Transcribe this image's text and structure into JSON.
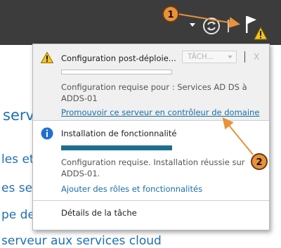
{
  "callouts": {
    "one": "1",
    "two": "2"
  },
  "background": {
    "line1": "serv",
    "line2": "les et",
    "line3": "es serv",
    "line4": "pe de",
    "line5": "serveur aux services cloud"
  },
  "task1": {
    "title": "Configuration post-déploie...",
    "task_button": "TÂCH...",
    "close": "X",
    "desc_line1": "Configuration requise pour : Services AD DS à",
    "desc_line2": "ADDS-01",
    "link": "Promouvoir ce serveur en contrôleur de domaine",
    "progress": 0
  },
  "task2": {
    "title": "Installation de fonctionnalité",
    "desc_line1": "Configuration requise. Installation réussie sur",
    "desc_line2": "ADDS-01.",
    "link": "Ajouter des rôles et fonctionnalités",
    "progress": 1
  },
  "footer": {
    "details": "Détails de la tâche"
  },
  "colors": {
    "topbar": "#3c3c3c",
    "link": "#1a6fa8",
    "callout": "#e8923a",
    "progress_fill": "#1e6f8e",
    "warning": "#f5c518"
  }
}
